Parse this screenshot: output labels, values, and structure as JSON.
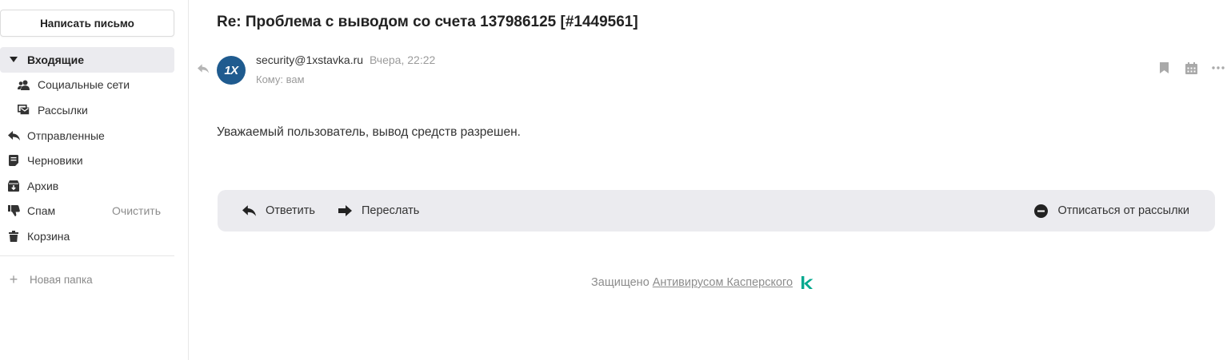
{
  "sidebar": {
    "compose_label": "Написать письмо",
    "folders": [
      {
        "label": "Входящие",
        "icon": "caret-down-icon",
        "active": true
      },
      {
        "label": "Социальные сети",
        "icon": "people-icon"
      },
      {
        "label": "Рассылки",
        "icon": "newsletter-icon"
      },
      {
        "label": "Отправленные",
        "icon": "reply-arrow-icon"
      },
      {
        "label": "Черновики",
        "icon": "draft-icon"
      },
      {
        "label": "Архив",
        "icon": "archive-icon"
      },
      {
        "label": "Спам",
        "icon": "thumbs-down-icon",
        "action": "Очистить"
      },
      {
        "label": "Корзина",
        "icon": "trash-icon"
      }
    ],
    "new_folder_label": "Новая папка"
  },
  "message": {
    "subject": "Re: Проблема с выводом со счета 137986125 [#1449561]",
    "avatar_text": "1X",
    "sender_email": "security@1xstavka.ru",
    "date": "Вчера, 22:22",
    "to": "Кому: вам",
    "body": "Уважаемый пользователь, вывод средств разрешен."
  },
  "actions": {
    "reply_label": "Ответить",
    "forward_label": "Переслать",
    "unsubscribe_label": "Отписаться от рассылки"
  },
  "footer": {
    "protected_text": "Защищено",
    "link_text": "Антивирусом Касперского"
  },
  "colors": {
    "avatar_bg": "#1f5b8f",
    "active_folder_bg": "#ebebef",
    "action_bar_bg": "#ebebef",
    "kaspersky_green": "#00a88e"
  }
}
